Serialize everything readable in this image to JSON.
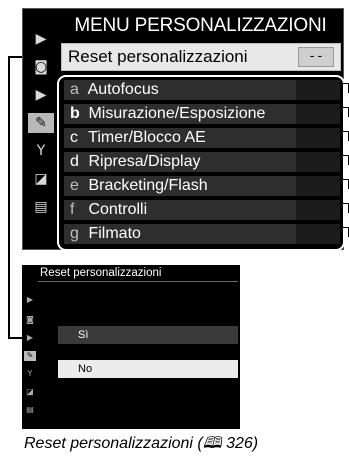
{
  "menu": {
    "title": "MENU PERSONALIZZAZIONI",
    "reset_label": "Reset personalizzazioni",
    "reset_value": "--",
    "groups": [
      {
        "letter": "a",
        "label": "Autofocus"
      },
      {
        "letter": "b",
        "label": "Misurazione/Esposizione"
      },
      {
        "letter": "c",
        "label": "Timer/Blocco AE"
      },
      {
        "letter": "d",
        "label": "Ripresa/Display"
      },
      {
        "letter": "e",
        "label": "Bracketing/Flash"
      },
      {
        "letter": "f",
        "label": "Controlli"
      },
      {
        "letter": "g",
        "label": "Filmato"
      }
    ],
    "side_icons": [
      "playback-icon",
      "camera-icon",
      "movie-icon",
      "pencil-icon",
      "wrench-icon",
      "retouch-icon",
      "my-menu-icon"
    ]
  },
  "submenu": {
    "title": "Reset personalizzazioni",
    "options": [
      "Sì",
      "No"
    ],
    "selected": "No"
  },
  "caption": {
    "text": "Reset personalizzazioni (",
    "book_glyph": "ὖE",
    "page": "326",
    "close": ")"
  }
}
